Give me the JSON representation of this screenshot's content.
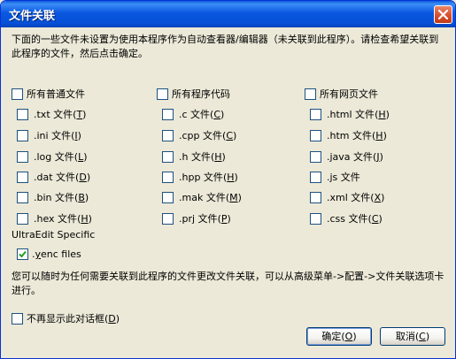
{
  "window": {
    "title": "文件关联"
  },
  "intro_text": "下面的一些文件未设置为使用本程序作为自动查看器/编辑器（未关联到此程序）。请检查希望关联到此程序的文件，然后点击确定。",
  "columns": [
    {
      "header": "所有普通文件",
      "items": [
        {
          "label": ".txt 文件",
          "key": "T"
        },
        {
          "label": ".ini 文件",
          "key": "I"
        },
        {
          "label": ".log 文件",
          "key": "L"
        },
        {
          "label": ".dat 文件",
          "key": "D"
        },
        {
          "label": ".bin 文件",
          "key": "B"
        },
        {
          "label": ".hex 文件",
          "key": "H"
        }
      ]
    },
    {
      "header": "所有程序代码",
      "items": [
        {
          "label": ".c 文件",
          "key": "C"
        },
        {
          "label": ".cpp 文件",
          "key": "C"
        },
        {
          "label": ".h 文件",
          "key": "H"
        },
        {
          "label": ".hpp 文件",
          "key": "H"
        },
        {
          "label": ".mak 文件",
          "key": "M"
        },
        {
          "label": ".prj 文件",
          "key": "P"
        }
      ]
    },
    {
      "header": "所有网页文件",
      "items": [
        {
          "label": ".html 文件",
          "key": "H"
        },
        {
          "label": ".htm 文件",
          "key": "H"
        },
        {
          "label": ".java 文件",
          "key": "J"
        },
        {
          "label": ".js 文件",
          "key": ""
        },
        {
          "label": ".xml 文件",
          "key": "X"
        },
        {
          "label": ".css 文件",
          "key": "C"
        }
      ]
    }
  ],
  "ultraedit": {
    "section_label": "UltraEdit Specific",
    "items": [
      {
        "prefix": ".",
        "key": "y",
        "suffix": "enc files",
        "checked": true
      }
    ]
  },
  "tip_text": "您可以随时为任何需要关联到此程序的文件更改文件关联，可以从高级菜单->配置->文件关联选项卡进行。",
  "dont_show": {
    "label": "不再显示此对话框",
    "key": "D"
  },
  "buttons": {
    "ok": {
      "label": "确定",
      "key": "O"
    },
    "cancel": {
      "label": "取消",
      "key": "C"
    }
  }
}
